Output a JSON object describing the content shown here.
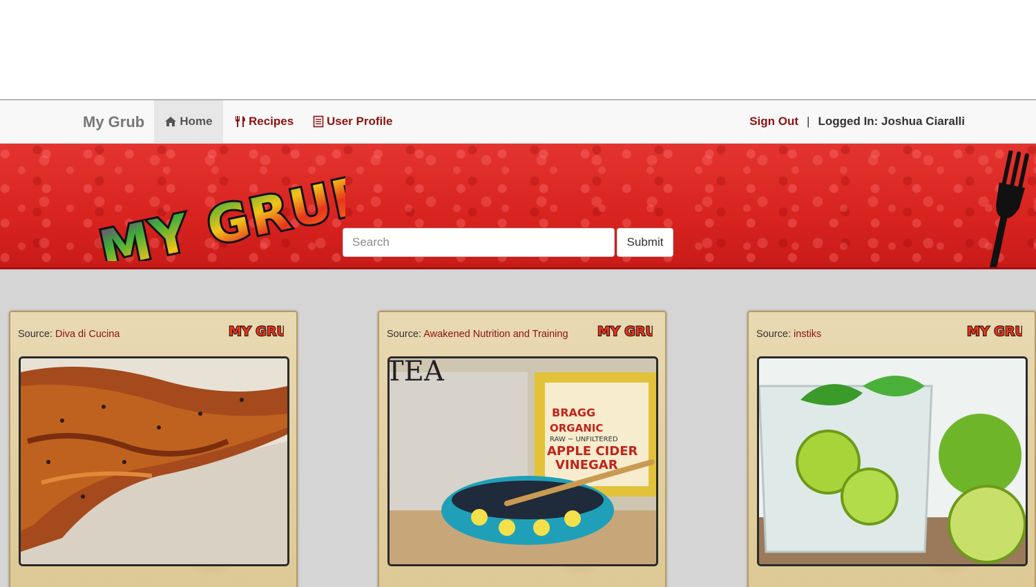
{
  "navbar": {
    "brand": "My Grub",
    "items": [
      {
        "label": "Home",
        "icon": "home-icon",
        "active": true
      },
      {
        "label": "Recipes",
        "icon": "cutlery-icon"
      },
      {
        "label": "User Profile",
        "icon": "list-alt-icon"
      }
    ],
    "sign_out": "Sign Out",
    "separator": "|",
    "logged_in": "Logged In: Joshua Ciaralli"
  },
  "banner": {
    "logo_text": "MY GRUB",
    "search": {
      "placeholder": "Search",
      "value": ""
    },
    "submit_label": "Submit"
  },
  "cards": [
    {
      "source_label": "Source:",
      "source_name": "Diva di Cucina",
      "image": "glazed-salmon"
    },
    {
      "source_label": "Source:",
      "source_name": "Awakened Nutrition and Training",
      "image": "apple-cider-vinegar-tea",
      "image_text": [
        "TEA",
        "BRAGG",
        "ORGANIC",
        "RAW ~ UNFILTERED",
        "APPLE CIDER",
        "VINEGAR"
      ]
    },
    {
      "source_label": "Source:",
      "source_name": "instiks",
      "image": "lime-mint-water"
    }
  ],
  "colors": {
    "accent": "#8b1212",
    "banner_red": "#d8231f",
    "content_bg": "#d5d5d5",
    "card_bg": "#e2d0a3"
  }
}
